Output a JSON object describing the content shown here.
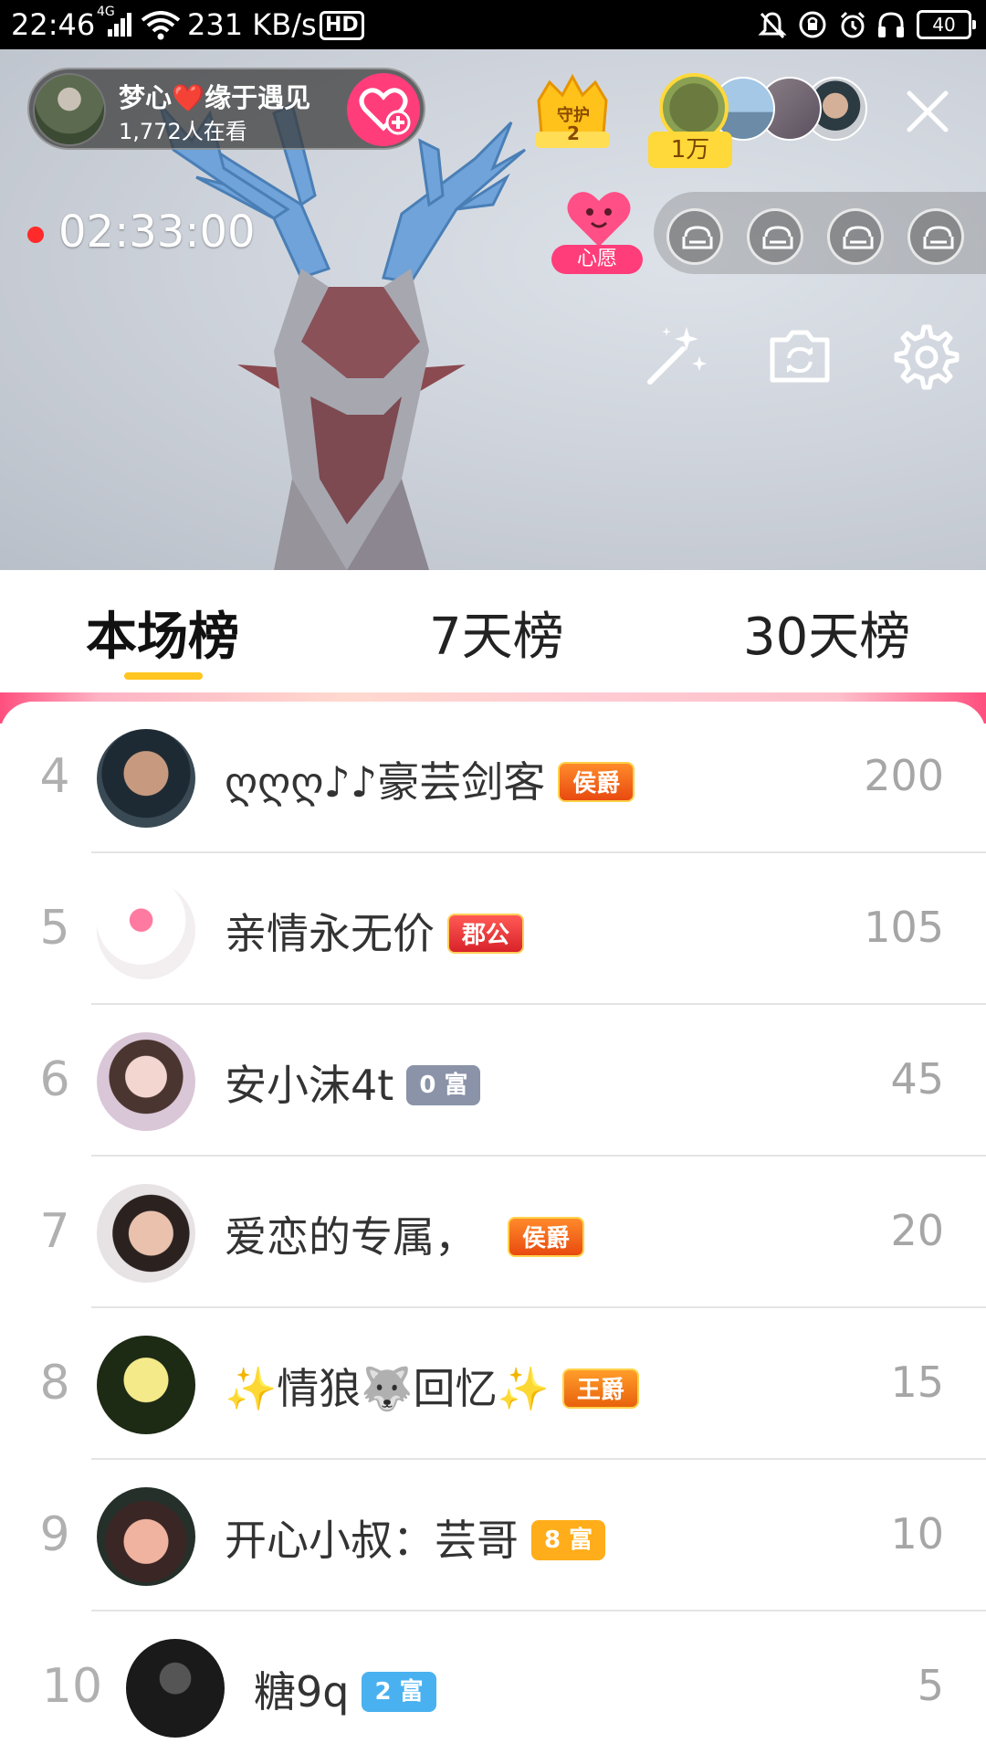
{
  "status_bar": {
    "time": "22:46",
    "network": "4G",
    "speed": "231 KB/s",
    "hd": "HD",
    "battery": "40",
    "icons": [
      "signal-icon",
      "wifi-icon",
      "mute-icon",
      "rotation-lock-icon",
      "alarm-icon",
      "headphones-icon"
    ]
  },
  "stream": {
    "streamer_name": "梦心❤️缘于遇见",
    "viewers": "1,772人在看",
    "guard_label": "守护",
    "guard_count": "2",
    "fans_badge": "1万",
    "live_time": "02:33:00",
    "wish_label": "心愿"
  },
  "tabs": [
    {
      "label": "本场榜",
      "active": true
    },
    {
      "label": "7天榜",
      "active": false
    },
    {
      "label": "30天榜",
      "active": false
    }
  ],
  "ranking": [
    {
      "rank": "4",
      "name": "ღღღ♪♪豪芸剑客",
      "badge": "侯爵",
      "badge_type": "houjue",
      "score": "200"
    },
    {
      "rank": "5",
      "name": "亲情永无价",
      "badge": "郡公",
      "badge_type": "jungong",
      "score": "105"
    },
    {
      "rank": "6",
      "name": "安小沫4t",
      "badge": "0 富",
      "badge_type": "fu-gray",
      "score": "45"
    },
    {
      "rank": "7",
      "name": "爱恋的专属，",
      "badge": "侯爵",
      "badge_type": "houjue",
      "score": "20"
    },
    {
      "rank": "8",
      "name": "✨情狼🐺回忆✨",
      "badge": "王爵",
      "badge_type": "wangjue",
      "score": "15"
    },
    {
      "rank": "9",
      "name": "开心小叔：芸哥",
      "badge": "8 富",
      "badge_type": "fu-orange",
      "score": "10"
    },
    {
      "rank": "10",
      "name": "糖9q",
      "badge": "2 富",
      "badge_type": "fu-blue",
      "score": "5"
    }
  ],
  "colors": {
    "accent_pink": "#ff3d7a",
    "tab_indicator": "#ffc520",
    "status_bar_bg": "#000000"
  }
}
